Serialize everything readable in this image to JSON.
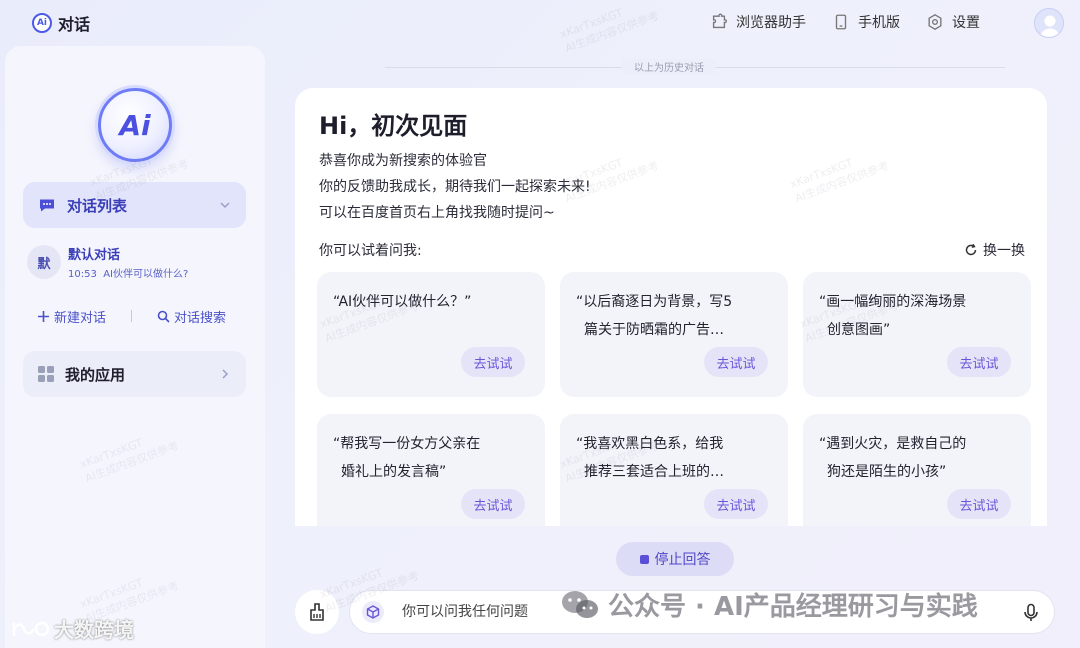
{
  "app": {
    "title": "对话",
    "logo_text": "Ai"
  },
  "topbar": {
    "actions": [
      {
        "label": "浏览器助手",
        "icon": "puzzle-icon"
      },
      {
        "label": "手机版",
        "icon": "phone-icon"
      },
      {
        "label": "设置",
        "icon": "gear-icon"
      }
    ]
  },
  "sidebar": {
    "logo_text": "Ai",
    "conversation_list_label": "对话列表",
    "current_conversation": {
      "avatar_char": "默",
      "title": "默认对话",
      "time": "10:53",
      "preview": "AI伙伴可以做什么?"
    },
    "new_conversation_label": "新建对话",
    "search_conversation_label": "对话搜索",
    "my_apps_label": "我的应用"
  },
  "main": {
    "history_divider": "以上为历史对话",
    "greeting": "Hi，初次见面",
    "intro_lines": [
      "恭喜你成为新搜索的体验官",
      "你的反馈助我成长，期待我们一起探索未来!",
      "可以在百度首页右上角找我随时提问~"
    ],
    "try_label": "你可以试着问我:",
    "refresh_label": "换一换",
    "try_button_label": "去试试",
    "suggestions": [
      {
        "line1": "“AI伙伴可以做什么？”",
        "line2": ""
      },
      {
        "line1": "“以后裔逐日为背景，写5",
        "line2": "篇关于防晒霜的广告…"
      },
      {
        "line1": "“画一幅绚丽的深海场景",
        "line2": "创意图画”"
      },
      {
        "line1": "“帮我写一份女方父亲在",
        "line2": "婚礼上的发言稿”"
      },
      {
        "line1": "“我喜欢黑白色系，给我",
        "line2": "推荐三套适合上班的…"
      },
      {
        "line1": "“遇到火灾，是救自己的",
        "line2": "狗还是陌生的小孩”"
      }
    ],
    "stop_label": "停止回答",
    "input_placeholder": "你可以问我任何问题"
  },
  "watermark": {
    "line1": "xKarTxsKGT",
    "line2": "AI生成内容仅供参考"
  },
  "overlays": {
    "wechat_text": "公众号 · AI产品经理研习与实践",
    "corner_text": "大数跨境"
  },
  "colors": {
    "accent": "#4b50e0",
    "primary_text": "#3a3fb8",
    "try_button_bg": "#e5e3f8",
    "stop_button_bg": "#dcdcf7"
  }
}
